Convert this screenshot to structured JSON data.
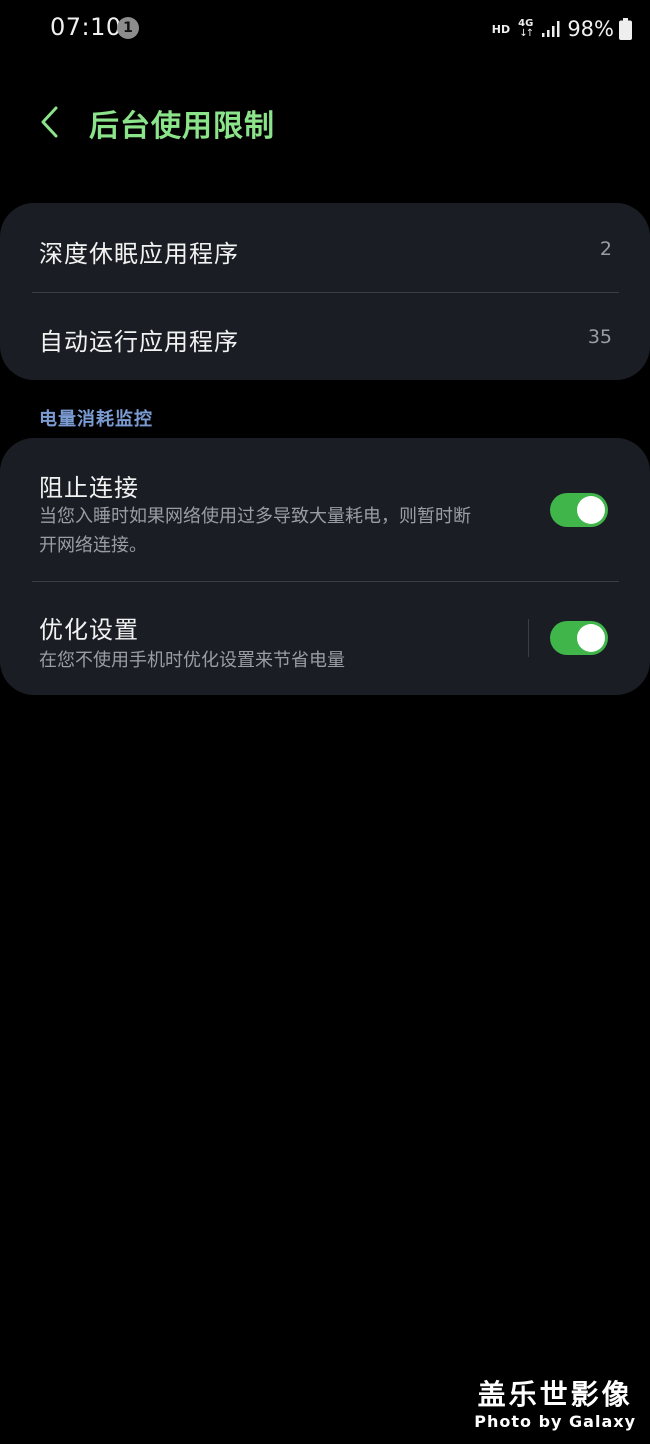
{
  "status_bar": {
    "time": "07:10",
    "notification_count": "1",
    "hd_label": "HD",
    "network_label": "4G",
    "network_arrows": "↓↑",
    "battery_percent": "98%",
    "signal_icon": "signal-icon",
    "battery_icon": "battery-icon"
  },
  "header": {
    "back_icon": "chevron-left-icon",
    "title": "后台使用限制"
  },
  "apps_card": {
    "items": [
      {
        "label": "深度休眠应用程序",
        "count": "2"
      },
      {
        "label": "自动运行应用程序",
        "count": "35"
      }
    ]
  },
  "section_header": "电量消耗监控",
  "monitor_card": {
    "items": [
      {
        "label": "阻止连接",
        "description_line1": "当您入睡时如果网络使用过多导致大量耗电，则暂时断",
        "description_line2": "开网络连接。",
        "toggle_on": true
      },
      {
        "label": "优化设置",
        "description": "在您不使用手机时优化设置来节省电量",
        "toggle_on": true
      }
    ]
  },
  "colors": {
    "accent_title": "#8be38a",
    "section_header": "#7b9bd3",
    "toggle_on": "#3fb54a",
    "card_bg": "#1a1e24"
  },
  "watermark": {
    "title": "盖乐世影像",
    "subtitle": "Photo by Galaxy"
  }
}
